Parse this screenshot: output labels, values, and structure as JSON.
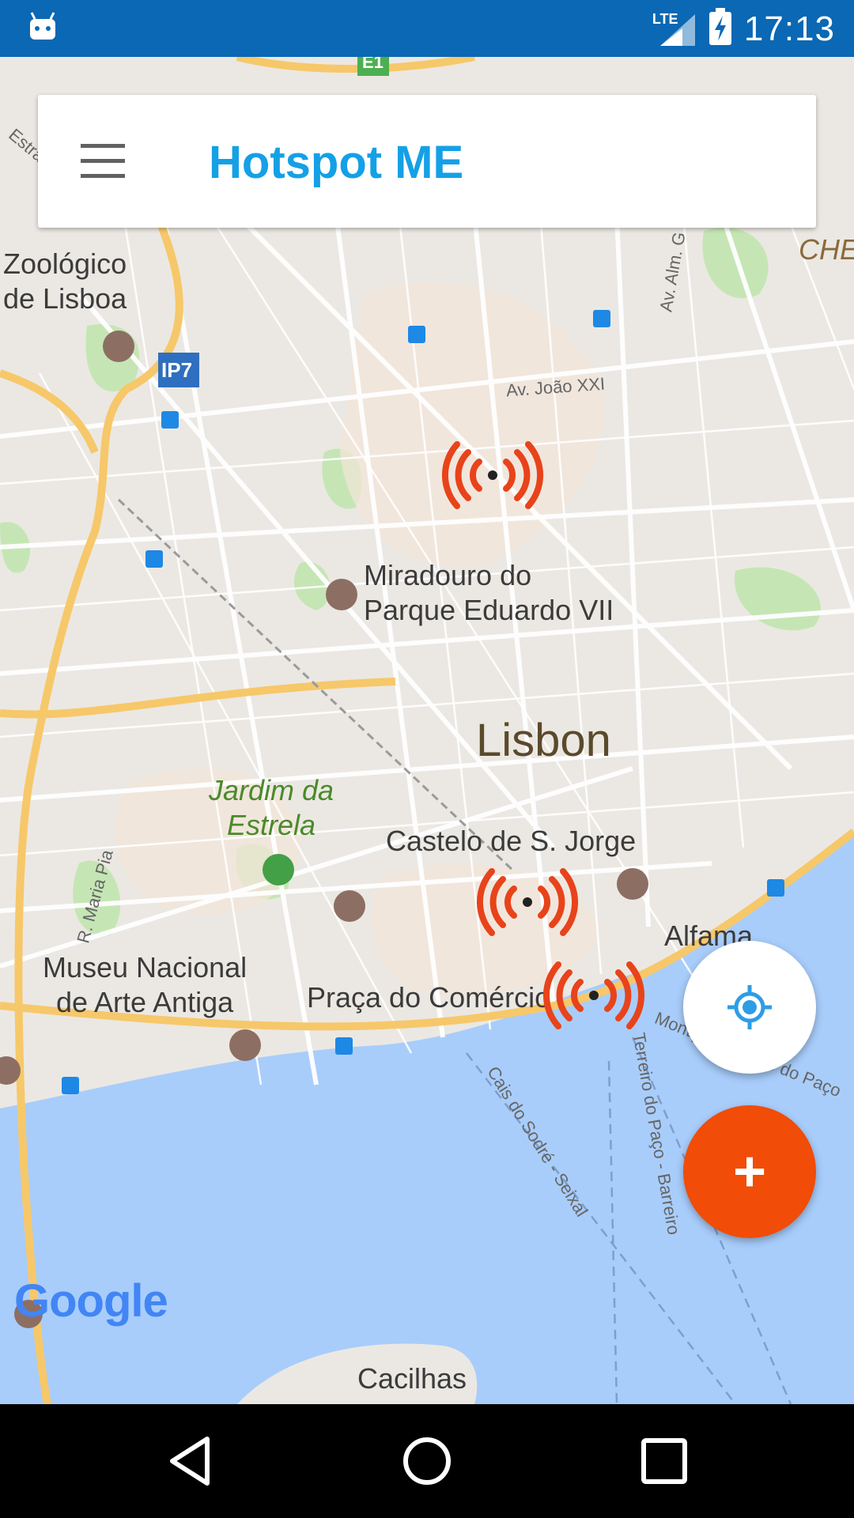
{
  "status_bar": {
    "time": "17:13",
    "network": "LTE",
    "icons": [
      "android-icon",
      "signal-icon",
      "battery-charging-icon"
    ]
  },
  "app_bar": {
    "title": "Hotspot ME",
    "menu_icon": "hamburger-menu-icon"
  },
  "map": {
    "labels": {
      "zoo": "Zoológico\nde Lisboa",
      "ip7": "IP7",
      "e1": "E1",
      "av_joao": "Av. João XXI",
      "miradouro": "Miradouro do\nParque Eduardo VII",
      "lisbon": "Lisbon",
      "jardim": "Jardim da\nEstrela",
      "castelo": "Castelo de S. Jorge",
      "alfama": "Alfama",
      "museu": "Museu Nacional\nde Arte Antiga",
      "praca": "Praça do Comércio",
      "cacilhas": "Cacilhas",
      "che": "CHE",
      "estra": "Estra",
      "av_alm": "Av. Alm. G",
      "r_maria_pia": "R. Maria Pia",
      "cais_sodre": "Cais do Sodré - Seixal",
      "terreiro_barreiro": "Terreiro do Paço - Barreiro",
      "montijo": "Montijo - Terreiro do Paço"
    },
    "attribution": "Google",
    "hotspot_count": 3
  },
  "actions": {
    "locate_icon": "my-location-icon",
    "add_label": "+"
  },
  "nav_bar": {
    "icons": [
      "back-icon",
      "home-icon",
      "recents-icon"
    ]
  },
  "colors": {
    "status_bar": "#0a68b4",
    "title": "#15a0e6",
    "fab_add": "#f14c08",
    "hotspot": "#e8431a",
    "water": "#a8cdfb",
    "land": "#ebe8e3"
  }
}
